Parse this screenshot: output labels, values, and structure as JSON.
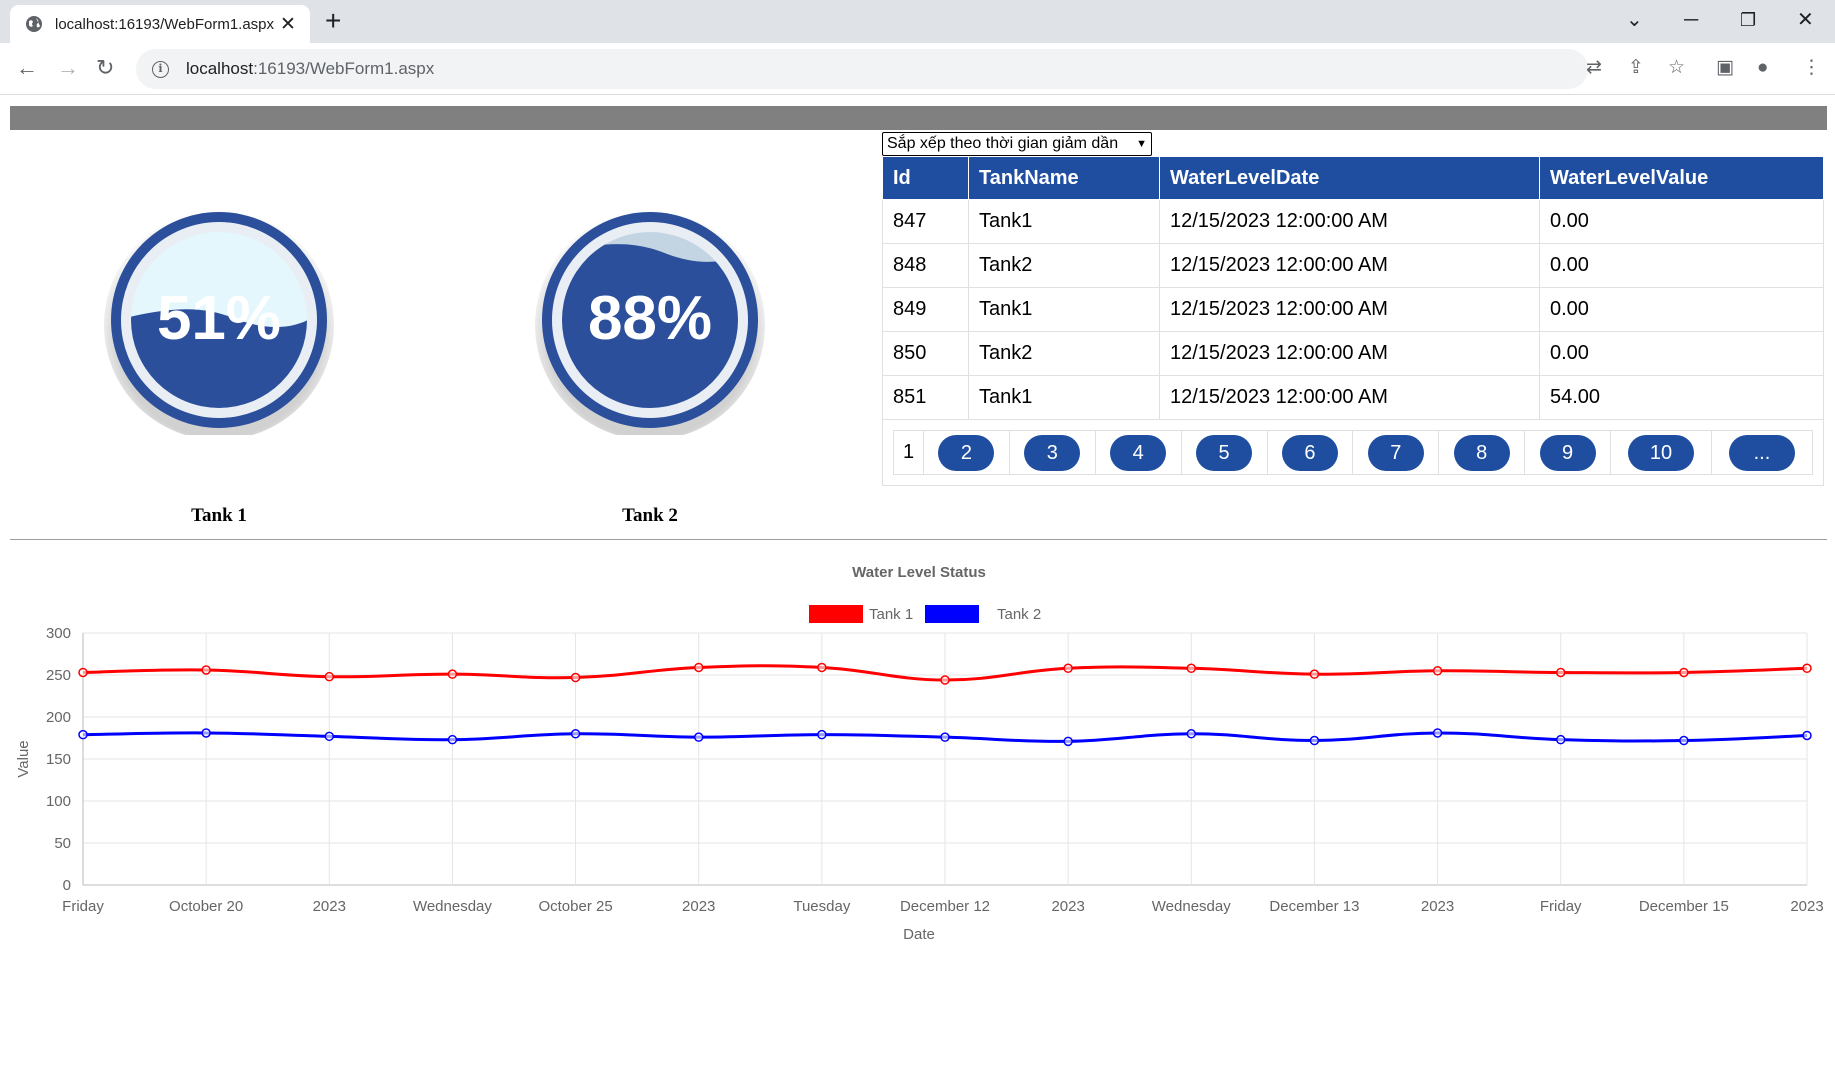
{
  "browser": {
    "tab_title": "localhost:16193/WebForm1.aspx",
    "url_host": "localhost",
    "url_path": ":16193/WebForm1.aspx"
  },
  "tanks": [
    {
      "label": "Tank 1",
      "percent_text": "51%",
      "level": 0.51
    },
    {
      "label": "Tank 2",
      "percent_text": "88%",
      "level": 0.88
    }
  ],
  "sort": {
    "selected": "Sắp xếp theo thời gian giảm dần"
  },
  "table": {
    "columns": [
      "Id",
      "TankName",
      "WaterLevelDate",
      "WaterLevelValue"
    ],
    "rows": [
      [
        "847",
        "Tank1",
        "12/15/2023 12:00:00 AM",
        "0.00"
      ],
      [
        "848",
        "Tank2",
        "12/15/2023 12:00:00 AM",
        "0.00"
      ],
      [
        "849",
        "Tank1",
        "12/15/2023 12:00:00 AM",
        "0.00"
      ],
      [
        "850",
        "Tank2",
        "12/15/2023 12:00:00 AM",
        "0.00"
      ],
      [
        "851",
        "Tank1",
        "12/15/2023 12:00:00 AM",
        "54.00"
      ]
    ],
    "pager": {
      "current": "1",
      "pages": [
        "2",
        "3",
        "4",
        "5",
        "6",
        "7",
        "8",
        "9",
        "10",
        "..."
      ]
    }
  },
  "colors": {
    "accent": "#1f4ea1",
    "tank1_line": "#ff0000",
    "tank2_line": "#0000ff"
  },
  "chart_data": {
    "type": "line",
    "title": "Water Level Status",
    "xlabel": "Date",
    "ylabel": "Value",
    "ylim": [
      0,
      300
    ],
    "yticks": [
      0,
      50,
      100,
      150,
      200,
      250,
      300
    ],
    "legend_position": "top",
    "grid": true,
    "categories": [
      "Friday",
      "October 20",
      "2023",
      "Wednesday",
      "October 25",
      "2023",
      "Tuesday",
      "December 12",
      "2023",
      "Wednesday",
      "December 13",
      "2023",
      "Friday",
      "December 15",
      "2023"
    ],
    "series": [
      {
        "name": "Tank 1",
        "color": "#ff0000",
        "values": [
          253,
          256,
          248,
          251,
          247,
          259,
          259,
          244,
          258,
          258,
          251,
          255,
          253,
          253,
          258
        ]
      },
      {
        "name": "Tank 2",
        "color": "#0000ff",
        "values": [
          179,
          181,
          177,
          173,
          180,
          176,
          179,
          176,
          171,
          180,
          172,
          181,
          173,
          172,
          178
        ]
      }
    ]
  }
}
